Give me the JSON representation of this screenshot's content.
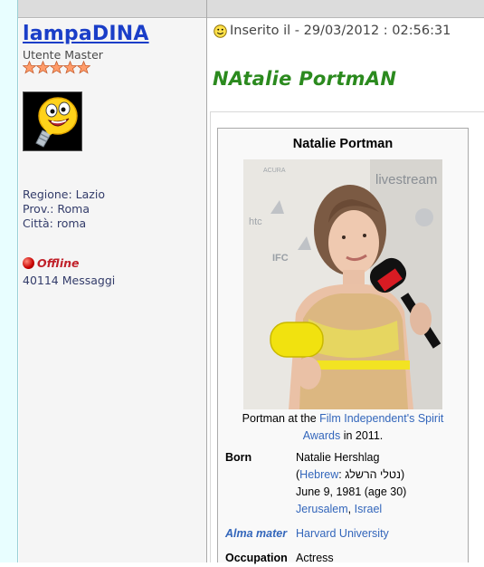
{
  "author": {
    "username": "lampaDINA",
    "rank": "Utente Master",
    "stars": 5,
    "region": "Regione: Lazio",
    "province": "Prov.: Roma",
    "city": "Città: roma",
    "status": "Offline",
    "messages": "40114 Messaggi"
  },
  "post": {
    "posted": "Inserito il - 29/03/2012 : 02:56:31",
    "title": "NAtalie PortmAN"
  },
  "infobox": {
    "title": "Natalie Portman",
    "caption_prefix": "Portman at the ",
    "caption_link": "Film Independent's Spirit Awards",
    "caption_suffix": " in 2011.",
    "born_label": "Born",
    "born_name": "Natalie Hershlag",
    "born_hebrew_open": "(",
    "born_hebrew_link": "Hebrew",
    "born_hebrew_text": ": נטלי הרשלג)",
    "born_date": "June 9, 1981 (age 30)",
    "born_place_1": "Jerusalem",
    "born_place_sep": ", ",
    "born_place_2": "Israel",
    "alma_label": "Alma mater",
    "alma_value": "Harvard University",
    "occupation_label": "Occupation",
    "occupation_value": "Actress",
    "photo_sign_1": "livestream",
    "photo_sign_2": "IFC",
    "photo_sign_3": "htc",
    "photo_sign_4": "ACURA"
  },
  "colors": {
    "username": "#1a3ec8",
    "title": "#2b8a1e",
    "link": "#3366bb",
    "offline": "#c0212a"
  }
}
